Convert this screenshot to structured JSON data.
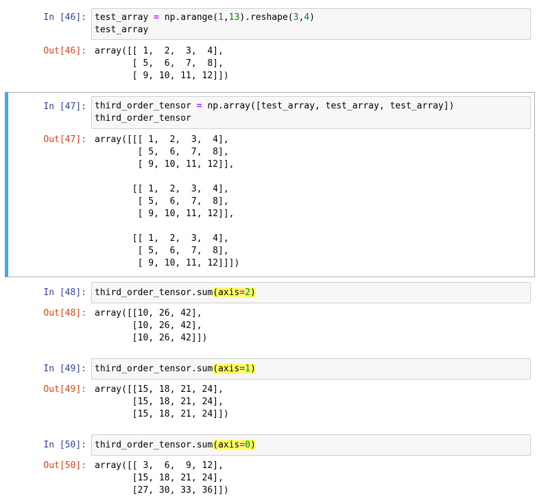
{
  "cells": [
    {
      "in_prompt": "In [46]:",
      "out_prompt": "Out[46]:",
      "code": [
        [
          {
            "t": "test_array "
          },
          {
            "t": "=",
            "c": "op"
          },
          {
            "t": " np.arange("
          },
          {
            "t": "1",
            "c": "num"
          },
          {
            "t": ","
          },
          {
            "t": "13",
            "c": "num"
          },
          {
            "t": ").reshape("
          },
          {
            "t": "3",
            "c": "num"
          },
          {
            "t": ","
          },
          {
            "t": "4",
            "c": "num"
          },
          {
            "t": ")"
          }
        ],
        [
          {
            "t": "test_array"
          }
        ]
      ],
      "output": "array([[ 1,  2,  3,  4],\n       [ 5,  6,  7,  8],\n       [ 9, 10, 11, 12]])"
    },
    {
      "in_prompt": "In [47]:",
      "out_prompt": "Out[47]:",
      "selected": true,
      "code": [
        [
          {
            "t": "third_order_tensor "
          },
          {
            "t": "=",
            "c": "op"
          },
          {
            "t": " np.array([test_array, test_array, test_array])"
          }
        ],
        [
          {
            "t": "third_order_tensor"
          }
        ]
      ],
      "output": "array([[[ 1,  2,  3,  4],\n        [ 5,  6,  7,  8],\n        [ 9, 10, 11, 12]],\n\n       [[ 1,  2,  3,  4],\n        [ 5,  6,  7,  8],\n        [ 9, 10, 11, 12]],\n\n       [[ 1,  2,  3,  4],\n        [ 5,  6,  7,  8],\n        [ 9, 10, 11, 12]]])"
    },
    {
      "in_prompt": "In [48]:",
      "out_prompt": "Out[48]:",
      "code": [
        [
          {
            "t": "third_order_tensor.sum"
          },
          {
            "t": "(axis",
            "c": "hl"
          },
          {
            "t": "=",
            "c": "hl op"
          },
          {
            "t": "2",
            "c": "hl num"
          },
          {
            "t": ")",
            "c": "hl"
          }
        ]
      ],
      "output": "array([[10, 26, 42],\n       [10, 26, 42],\n       [10, 26, 42]])"
    },
    {
      "in_prompt": "In [49]:",
      "out_prompt": "Out[49]:",
      "code": [
        [
          {
            "t": "third_order_tensor.sum"
          },
          {
            "t": "(axis",
            "c": "hl"
          },
          {
            "t": "=",
            "c": "hl op"
          },
          {
            "t": "1",
            "c": "hl num"
          },
          {
            "t": ")",
            "c": "hl"
          }
        ]
      ],
      "output": "array([[15, 18, 21, 24],\n       [15, 18, 21, 24],\n       [15, 18, 21, 24]])"
    },
    {
      "in_prompt": "In [50]:",
      "out_prompt": "Out[50]:",
      "code": [
        [
          {
            "t": "third_order_tensor.sum"
          },
          {
            "t": "(axis",
            "c": "hl"
          },
          {
            "t": "=",
            "c": "hl op"
          },
          {
            "t": "0",
            "c": "hl num"
          },
          {
            "t": ")",
            "c": "hl"
          }
        ]
      ],
      "output": "array([[ 3,  6,  9, 12],\n       [15, 18, 21, 24],\n       [27, 30, 33, 36]])"
    }
  ],
  "colors": {
    "in_prompt": "#303f9f",
    "out_prompt": "#d84315",
    "selected_bar": "#42a5f5",
    "highlight": "#ffff66",
    "operator": "#aa22ff",
    "number": "#008800"
  }
}
